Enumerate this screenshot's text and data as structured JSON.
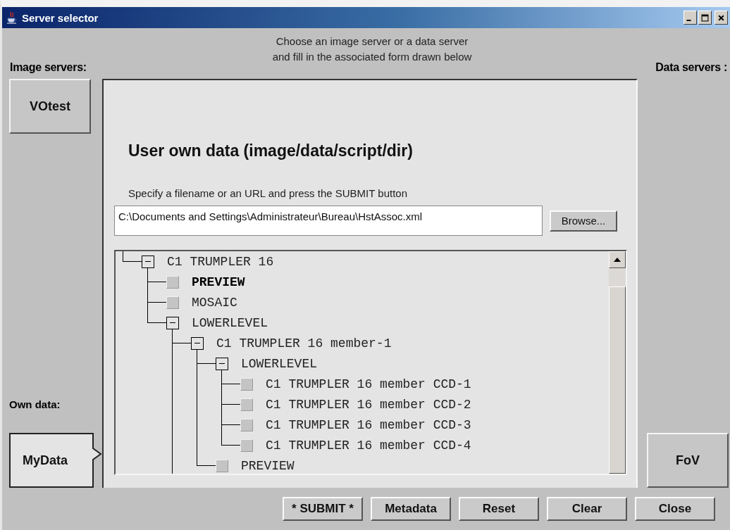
{
  "window": {
    "title": "Server selector"
  },
  "header": {
    "instructions": [
      "Choose an image server or a data server",
      "and fill in the associated form drawn below"
    ]
  },
  "image_servers": {
    "label": "Image servers:",
    "items": [
      {
        "label": "VOtest",
        "selected": false
      }
    ]
  },
  "data_servers": {
    "label": "Data servers :",
    "items": [
      {
        "label": "FoV",
        "selected": false
      }
    ]
  },
  "own_data": {
    "label": "Own data:",
    "items": [
      {
        "label": "MyData",
        "selected": true
      }
    ]
  },
  "form": {
    "title": "User own data (image/data/script/dir)",
    "instruction": "Specify a filename or an URL and press the SUBMIT button",
    "file_field": {
      "value": "C:\\Documents and Settings\\Administrateur\\Bureau\\HstAssoc.xml"
    },
    "browse_button": "Browse...",
    "tree": [
      {
        "label": "C1 TRUMPLER 16",
        "kind": "folder",
        "expanded": true,
        "selected": false,
        "children": [
          {
            "label": "PREVIEW",
            "kind": "leaf",
            "selected": true
          },
          {
            "label": "MOSAIC",
            "kind": "leaf",
            "selected": false
          },
          {
            "label": "LOWERLEVEL",
            "kind": "folder",
            "expanded": true,
            "selected": false,
            "children": [
              {
                "label": "C1 TRUMPLER 16 member-1",
                "kind": "folder",
                "expanded": true,
                "selected": false,
                "more_below": true,
                "children": [
                  {
                    "label": "LOWERLEVEL",
                    "kind": "folder",
                    "expanded": true,
                    "selected": false,
                    "children": [
                      {
                        "label": "C1 TRUMPLER 16 member CCD-1",
                        "kind": "leaf",
                        "selected": false
                      },
                      {
                        "label": "C1 TRUMPLER 16 member CCD-2",
                        "kind": "leaf",
                        "selected": false
                      },
                      {
                        "label": "C1 TRUMPLER 16 member CCD-3",
                        "kind": "leaf",
                        "selected": false
                      },
                      {
                        "label": "C1 TRUMPLER 16 member CCD-4",
                        "kind": "leaf",
                        "selected": false
                      }
                    ]
                  },
                  {
                    "label": "PREVIEW",
                    "kind": "leaf",
                    "selected": false
                  }
                ]
              }
            ]
          }
        ]
      }
    ]
  },
  "buttons": [
    "* SUBMIT *",
    "Metadata",
    "Reset",
    "Clear",
    "Close"
  ]
}
